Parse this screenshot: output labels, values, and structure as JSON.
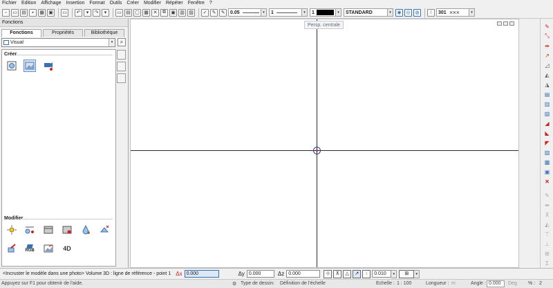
{
  "menu": [
    "Fichier",
    "Edition",
    "Affichage",
    "Insertion",
    "Format",
    "Outils",
    "Créer",
    "Modifier",
    "Répéter",
    "Fenêtre",
    "?"
  ],
  "toolbar": {
    "line_weight": "0.05",
    "line_type": "1",
    "color_index": "1",
    "style": "STANDARD",
    "hatch": "301"
  },
  "panel": {
    "title": "Fonctions",
    "tabs": [
      "Fonctions",
      "Propriétés",
      "Bibliothèque"
    ],
    "active_tab": "Fonctions",
    "module": "Visual",
    "section_create": "Créer",
    "section_modify": "Modifier",
    "rgb_label": "RGB",
    "label_4d": "4D"
  },
  "view": {
    "badge": "Persp. centrale"
  },
  "command": {
    "prompt": "<Incruster le modèle dans une photo> Volume 3D : ligne de référence - point 1",
    "dx_label": "Δx",
    "dx_value": "0.000",
    "dy_label": "Δy",
    "dy_value": "0.000",
    "dz_label": "Δz",
    "dz_value": "0.000",
    "step_value": "0.010"
  },
  "status": {
    "help": "Appuyez sur F1 pour obtenir de l'aide.",
    "drawing_type_label": "Type de dessin:",
    "drawing_type_value": "Définition de l'échelle",
    "scale_label": "Echelle :",
    "scale_value": "1 : 100",
    "length_label": "Longueur :",
    "length_unit": "m",
    "angle_label": "Angle :",
    "angle_value": "0.000",
    "angle_unit": "Deg",
    "percent_label": "% :",
    "percent_value": "2"
  },
  "colors": {
    "accent": "#3a6fb0",
    "axis": "#2b2b2b",
    "crosshair": "#2a3a9a",
    "red": "#cc2222"
  }
}
